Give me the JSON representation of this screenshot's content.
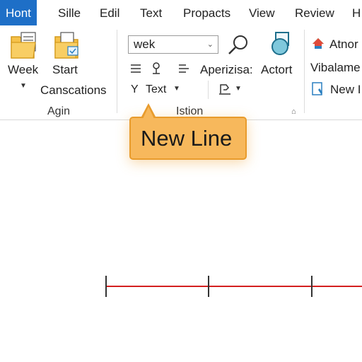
{
  "menu": {
    "tabs": [
      {
        "label": "Hont",
        "active": true
      },
      {
        "label": "Sille"
      },
      {
        "label": "Edil"
      },
      {
        "label": "Text"
      },
      {
        "label": "Propacts"
      },
      {
        "label": "View"
      },
      {
        "label": "Review"
      },
      {
        "label": "H"
      }
    ]
  },
  "ribbon": {
    "group1": {
      "week_label": "Week",
      "start_label": "Start",
      "cancel_label": "Canscations",
      "group_label": "Agin"
    },
    "group2": {
      "dropdown_value": "wek",
      "aperizisa_label": "Aperizisa:",
      "text_label": "Text",
      "text_prefix": "Y",
      "group_label": "Istion"
    },
    "group3": {
      "actort_label": "Actort"
    },
    "group4": {
      "atnor_label": "Atnor",
      "vibalame_label": "Vibalame",
      "new_label": "New I"
    }
  },
  "tooltip": {
    "text": "New Line"
  },
  "colors": {
    "accent": "#1e6fc7",
    "callout_fill": "#f7b85c",
    "callout_border": "#e89b2c",
    "line": "#d42020"
  }
}
